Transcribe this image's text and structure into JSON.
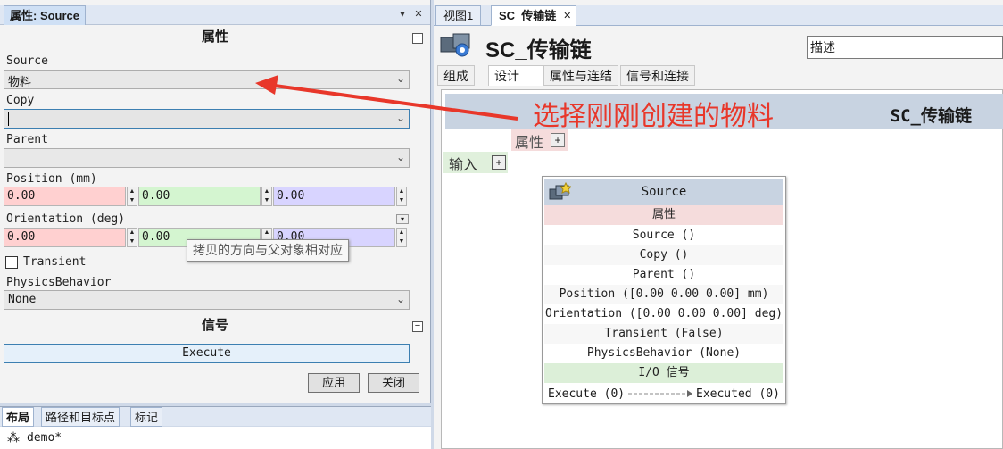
{
  "left_panel": {
    "title": "属性: Source",
    "pin_glyph": "▾",
    "close_glyph": "✕",
    "sections": {
      "properties_title": "属性",
      "signals_title": "信号",
      "collapse_glyph": "−"
    },
    "fields": {
      "source_label": "Source",
      "source_value": "物料",
      "copy_label": "Copy",
      "copy_value": "",
      "parent_label": "Parent",
      "parent_value": "",
      "position_label": "Position (mm)",
      "position_values": [
        "0.00",
        "0.00",
        "0.00"
      ],
      "orientation_label": "Orientation (deg)",
      "orientation_values": [
        "0.00",
        "0.00",
        "0.00"
      ],
      "transient_label": "Transient",
      "transient_checked": false,
      "physics_label": "PhysicsBehavior",
      "physics_value": "None"
    },
    "execute_button": "Execute",
    "apply_button": "应用",
    "close_button": "关闭",
    "tooltip": "拷贝的方向与父对象相对应"
  },
  "bottom_left": {
    "tabs": [
      "布局",
      "路径和目标点",
      "标记"
    ],
    "tree_item": "demo*"
  },
  "editor": {
    "doc_tabs": [
      "视图1",
      "SC_传输链"
    ],
    "doc_tab_close": "✕",
    "title": "SC_传输链",
    "description_input": "描述",
    "sub_tabs": [
      "组成",
      "设计",
      "属性与连结",
      "信号和连接"
    ],
    "canvas_title": "SC_传输链",
    "annotation": "选择刚刚创建的物料",
    "properties_chip": "属性",
    "inputs_chip": "输入",
    "plus_glyph": "+",
    "node": {
      "title": "Source",
      "properties_header": "属性",
      "rows": [
        "Source ()",
        "Copy ()",
        "Parent ()",
        "Position ([0.00 0.00 0.00] mm)",
        "Orientation ([0.00 0.00 0.00] deg)",
        "Transient (False)",
        "PhysicsBehavior (None)"
      ],
      "io_header": "I/O 信号",
      "io_in": "Execute (0)",
      "io_out": "Executed (0)"
    }
  },
  "colors": {
    "annotation_red": "#e8372a",
    "x_field": "#ffd0d0",
    "y_field": "#d4f5d0",
    "z_field": "#d8d4ff"
  }
}
